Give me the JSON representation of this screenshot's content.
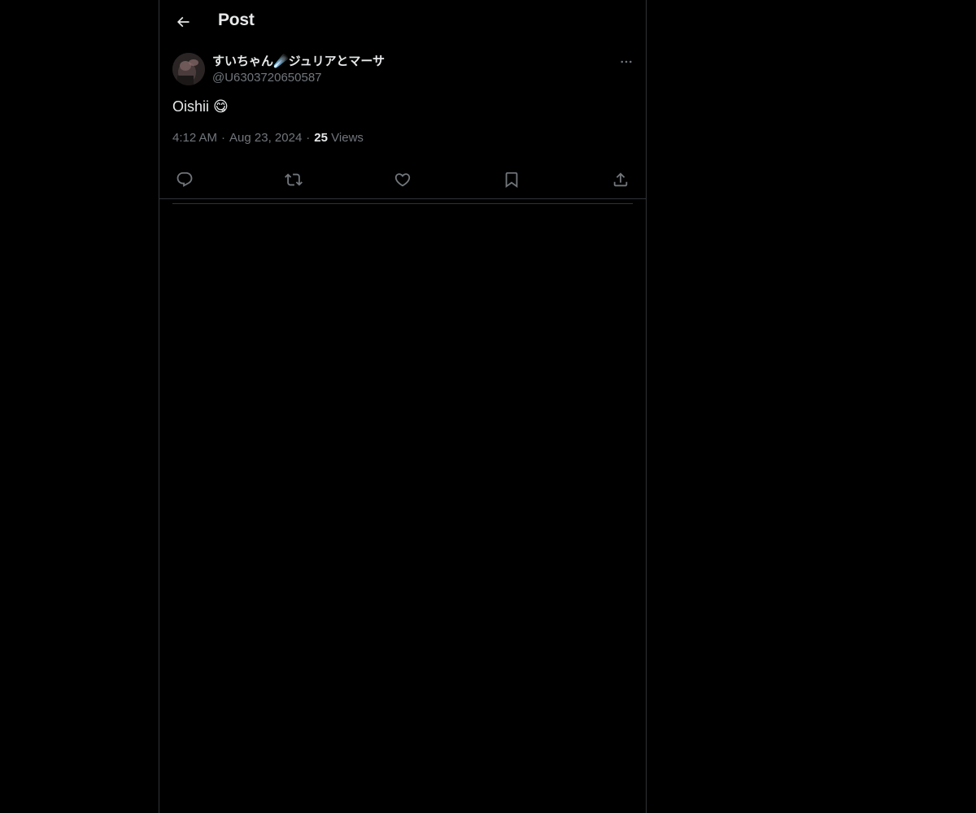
{
  "header": {
    "title": "Post",
    "back_icon": "arrow-left-icon"
  },
  "post": {
    "author": {
      "display_name": "すいちゃん☄️ジュリアとマーサ",
      "handle": "@U6303720650587"
    },
    "text": "Oishii 😋",
    "time": "4:12 AM",
    "date": "Aug 23, 2024",
    "views_count": "25",
    "views_label": "Views",
    "separator": "·"
  },
  "actions": [
    {
      "name": "reply",
      "icon": "reply-icon"
    },
    {
      "name": "repost",
      "icon": "repost-icon"
    },
    {
      "name": "like",
      "icon": "heart-icon"
    },
    {
      "name": "bookmark",
      "icon": "bookmark-icon"
    },
    {
      "name": "share",
      "icon": "share-icon"
    }
  ],
  "colors": {
    "background": "#000000",
    "text_primary": "#e7e9ea",
    "text_secondary": "#71767b",
    "border": "#2f3336"
  }
}
